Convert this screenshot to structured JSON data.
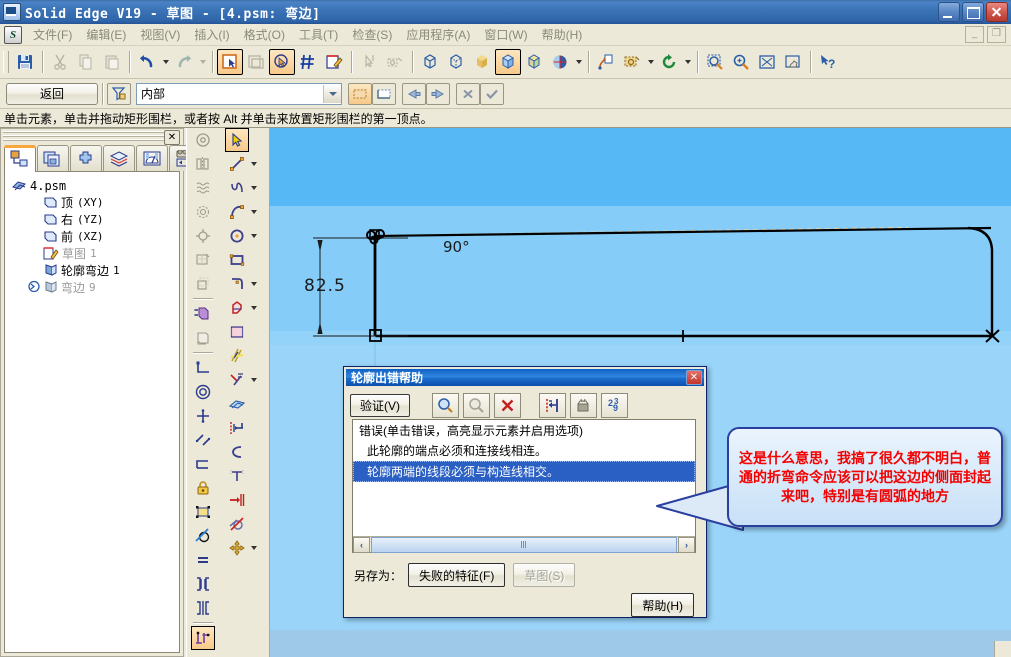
{
  "window": {
    "title": "Solid Edge V19 - 草图 - [4.psm: 弯边]",
    "icon": "solid-edge-icon",
    "minimize": "_",
    "maximize": "□",
    "close": "✕"
  },
  "menubar": {
    "app_icon_letter": "S",
    "items": [
      {
        "label": "文件(F)"
      },
      {
        "label": "编辑(E)"
      },
      {
        "label": "视图(V)"
      },
      {
        "label": "插入(I)"
      },
      {
        "label": "格式(O)"
      },
      {
        "label": "工具(T)"
      },
      {
        "label": "检查(S)"
      },
      {
        "label": "应用程序(A)"
      },
      {
        "label": "窗口(W)"
      },
      {
        "label": "帮助(H)"
      }
    ],
    "doc_minimize": "_",
    "doc_restore": "❐"
  },
  "toolbar": {
    "items": [
      {
        "name": "save-icon"
      },
      {
        "name": "cut-icon"
      },
      {
        "name": "copy-icon"
      },
      {
        "name": "paste-icon"
      },
      {
        "name": "undo-icon"
      },
      {
        "name": "undo-dropdown"
      },
      {
        "name": "redo-icon"
      },
      {
        "name": "redo-dropdown"
      },
      {
        "name": "select-tool-icon"
      },
      {
        "name": "select-face-icon"
      },
      {
        "name": "highlight-icon"
      },
      {
        "name": "grid-icon"
      },
      {
        "name": "sketch-edit-icon"
      },
      {
        "name": "pointer-pick-icon"
      },
      {
        "name": "camera-pick-icon"
      },
      {
        "name": "view-wireframe-icon"
      },
      {
        "name": "view-hidden-icon"
      },
      {
        "name": "view-shaded-icon"
      },
      {
        "name": "view-shaded-edges-icon"
      },
      {
        "name": "view-shaded-visible-icon"
      },
      {
        "name": "render-sphere-icon"
      },
      {
        "name": "render-dropdown"
      },
      {
        "name": "part-paint-icon"
      },
      {
        "name": "assembly-tag-icon"
      },
      {
        "name": "assembly-dropdown"
      },
      {
        "name": "rotate-view-icon"
      },
      {
        "name": "rotate-dropdown"
      },
      {
        "name": "zoom-area-icon"
      },
      {
        "name": "zoom-icon"
      },
      {
        "name": "fit-icon"
      },
      {
        "name": "pan-icon"
      },
      {
        "name": "help-pointer-icon"
      }
    ]
  },
  "cmdbar": {
    "back_label": "返回",
    "filter_icon": "selection-filter-icon",
    "layer_value": "内部",
    "layer_placeholder": "内部",
    "chain_icon": "chain-select-icon",
    "single_icon": "single-select-icon",
    "prev_icon": "arrow-left-icon",
    "next_icon": "arrow-right-icon",
    "cancel_icon": "cancel-icon",
    "accept_icon": "accept-icon"
  },
  "prompt": {
    "text": "单击元素，单击并拖动矩形围栏，或者按 Alt 并单击来放置矩形围栏的第一顶点。"
  },
  "dock": {
    "close_label": "✕",
    "tabs": [
      {
        "name": "tab-pathfinder",
        "icon": "feature-tree-icon",
        "active": true
      },
      {
        "name": "tab-library",
        "icon": "library-icon",
        "active": false
      },
      {
        "name": "tab-family",
        "icon": "family-parts-icon",
        "active": false
      },
      {
        "name": "tab-layers",
        "icon": "layers-icon",
        "active": false
      },
      {
        "name": "tab-sensors",
        "icon": "sensors-icon",
        "active": false
      },
      {
        "name": "tab-animation",
        "icon": "camera-icon",
        "active": false
      }
    ],
    "tree": [
      {
        "label": "4.psm",
        "icon": "part-file-icon",
        "indent": 0,
        "dim": false,
        "suffix": ""
      },
      {
        "label": "顶",
        "icon": "plane-icon",
        "indent": 1,
        "dim": false,
        "suffix": "(XY)"
      },
      {
        "label": "右",
        "icon": "plane-icon",
        "indent": 1,
        "dim": false,
        "suffix": "(YZ)"
      },
      {
        "label": "前",
        "icon": "plane-icon",
        "indent": 1,
        "dim": false,
        "suffix": "(XZ)"
      },
      {
        "label": "草图",
        "icon": "sketch-icon",
        "indent": 1,
        "dim": true,
        "suffix": "1"
      },
      {
        "label": "轮廓弯边",
        "icon": "contour-flange-icon",
        "indent": 1,
        "dim": false,
        "suffix": "1"
      },
      {
        "label": "弯边",
        "icon": "flange-icon",
        "indent": 1,
        "dim": true,
        "suffix": "9"
      }
    ]
  },
  "sketch_toolbars": {
    "left_column": [
      {
        "name": "circle-center-icon"
      },
      {
        "name": "mirror-icon"
      },
      {
        "name": "pattern-icon"
      },
      {
        "name": "circular-pattern-icon"
      },
      {
        "name": "target-point-icon"
      },
      {
        "name": "fill-region-icon"
      },
      {
        "name": "offset-region-icon"
      },
      {
        "name": "project-edge-icon"
      },
      {
        "name": "include-icon"
      },
      {
        "name": "connect-icon"
      },
      {
        "name": "concentric-icon"
      },
      {
        "name": "horizontal-vertical-icon"
      },
      {
        "name": "collinear-icon"
      },
      {
        "name": "parallel-icon"
      },
      {
        "name": "perpendicular-icon"
      },
      {
        "name": "lock-icon"
      },
      {
        "name": "rigid-set-icon"
      },
      {
        "name": "tangent-icon"
      },
      {
        "name": "equal-icon"
      },
      {
        "name": "symmetric-icon"
      },
      {
        "name": "symmetric-about-icon"
      },
      {
        "name": "relationship-handles-icon"
      }
    ],
    "right_column": [
      {
        "name": "select-arrow-icon",
        "selected": true
      },
      {
        "name": "line-icon",
        "dropdown": true
      },
      {
        "name": "curve-icon",
        "dropdown": true
      },
      {
        "name": "arc-icon",
        "dropdown": true
      },
      {
        "name": "circle-icon",
        "dropdown": true
      },
      {
        "name": "rectangle-icon"
      },
      {
        "name": "fillet-icon",
        "dropdown": true
      },
      {
        "name": "polygon-icon",
        "dropdown": true
      },
      {
        "name": "fill-hatch-icon"
      },
      {
        "name": "trim-icon"
      },
      {
        "name": "extend-icon",
        "dropdown": true
      },
      {
        "name": "sketch-plane-icon"
      },
      {
        "name": "smart-dimension-icon"
      },
      {
        "name": "distance-between-icon"
      },
      {
        "name": "angle-between-icon"
      },
      {
        "name": "coordinate-dimension-icon"
      },
      {
        "name": "delete-relationship-icon"
      },
      {
        "name": "move-icon",
        "dropdown": true
      }
    ]
  },
  "canvas": {
    "dimension_vertical": "82.5",
    "angle_label": "90°",
    "colors": {
      "bg_top": "#56b8f5",
      "bg_mid": "#85ccf8",
      "bg_low": "#93d2f9"
    }
  },
  "dialog": {
    "title": "轮廓出错帮助",
    "close_label": "✕",
    "verify_button": "验证(V)",
    "toolbar_icons": [
      {
        "name": "zoom-to-error-icon"
      },
      {
        "name": "zoom-out-error-icon"
      },
      {
        "name": "delete-error-icon"
      },
      {
        "name": "auto-close-icon"
      },
      {
        "name": "capture-icon"
      },
      {
        "name": "renumber-icon"
      }
    ],
    "list_header": "错误(单击错误，高亮显示元素并启用选项)",
    "errors": [
      {
        "text": "此轮廓的端点必须和连接线相连。",
        "selected": false
      },
      {
        "text": "轮廓两端的线段必须与构造线相交。",
        "selected": true
      }
    ],
    "scroll_left": "‹",
    "scroll_right": "›",
    "saveas_label": "另存为：",
    "saveas_failed_button": "失败的特征(F)",
    "saveas_sketch_button": "草图(S)",
    "help_button": "帮助(H)"
  },
  "callout": {
    "text": "这是什么意思，我搞了很久都不明白，普通的折弯命令应该可以把这边的侧面封起来吧，特别是有圆弧的地方",
    "text_color": "#f40000",
    "border_color": "#2a3fa0"
  }
}
